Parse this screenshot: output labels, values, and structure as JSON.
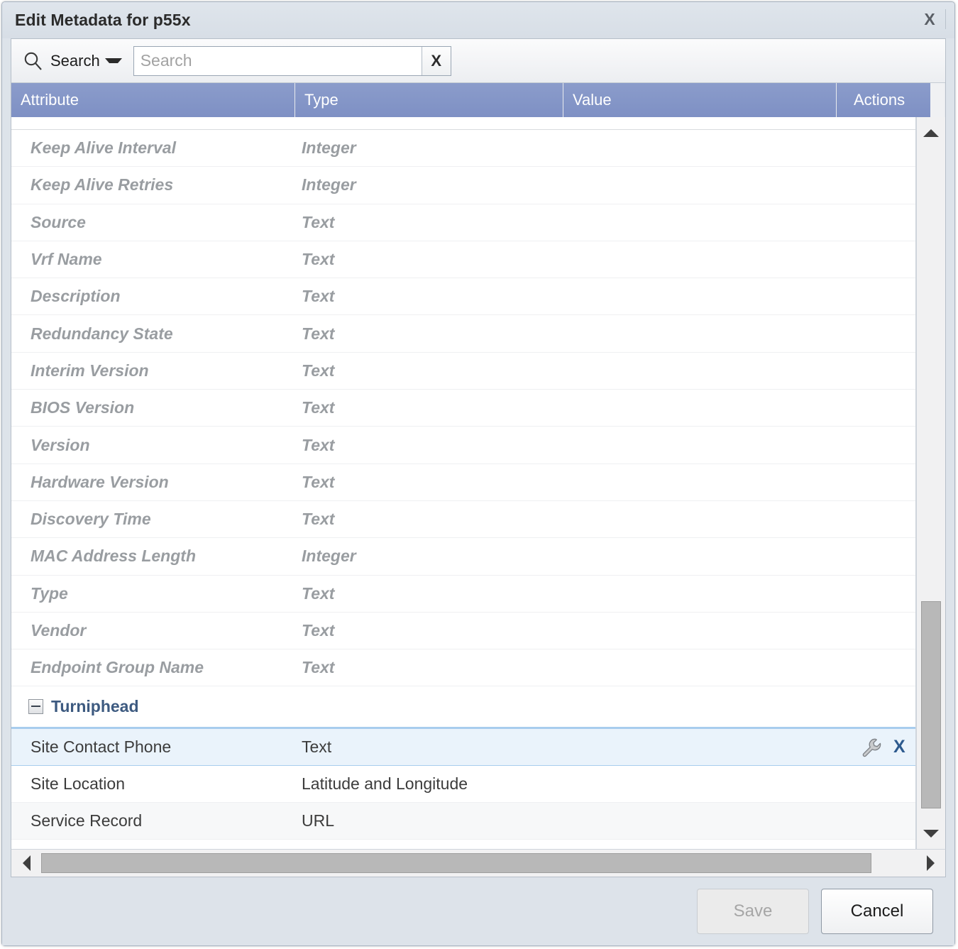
{
  "dialog": {
    "title": "Edit Metadata for p55x",
    "close_icon": "close-icon",
    "close_label": "X"
  },
  "toolbar": {
    "search_icon": "search-icon",
    "search_menu_label": "Search",
    "caret_icon": "chevron-down-icon",
    "search_value": "",
    "search_placeholder": "Search",
    "clear_label": "X"
  },
  "grid": {
    "columns": [
      "Attribute",
      "Type",
      "Value",
      "Actions"
    ],
    "clipped_row": {
      "attribute": "",
      "type": "",
      "value": ""
    },
    "inherited_rows": [
      {
        "attribute": "Keep Alive Interval",
        "type": "Integer",
        "value": ""
      },
      {
        "attribute": "Keep Alive Retries",
        "type": "Integer",
        "value": ""
      },
      {
        "attribute": "Source",
        "type": "Text",
        "value": ""
      },
      {
        "attribute": "Vrf Name",
        "type": "Text",
        "value": ""
      },
      {
        "attribute": "Description",
        "type": "Text",
        "value": ""
      },
      {
        "attribute": "Redundancy State",
        "type": "Text",
        "value": ""
      },
      {
        "attribute": "Interim Version",
        "type": "Text",
        "value": ""
      },
      {
        "attribute": "BIOS Version",
        "type": "Text",
        "value": ""
      },
      {
        "attribute": "Version",
        "type": "Text",
        "value": ""
      },
      {
        "attribute": "Hardware Version",
        "type": "Text",
        "value": ""
      },
      {
        "attribute": "Discovery Time",
        "type": "Text",
        "value": ""
      },
      {
        "attribute": "MAC Address Length",
        "type": "Integer",
        "value": ""
      },
      {
        "attribute": "Type",
        "type": "Text",
        "value": ""
      },
      {
        "attribute": "Vendor",
        "type": "Text",
        "value": ""
      },
      {
        "attribute": "Endpoint Group Name",
        "type": "Text",
        "value": ""
      }
    ],
    "group": {
      "label": "Turniphead",
      "toggle_icon": "collapse-minus-icon",
      "rows": [
        {
          "attribute": "Site Contact Phone",
          "type": "Text",
          "value": "",
          "selected": true,
          "edit_icon": "wrench-icon",
          "delete_icon": "close-icon",
          "delete_label": "X"
        },
        {
          "attribute": "Site Location",
          "type": "Latitude and Longitude",
          "value": "",
          "selected": false
        },
        {
          "attribute": "Service Record",
          "type": "URL",
          "value": "",
          "selected": false
        }
      ]
    }
  },
  "scrollbars": {
    "vertical": {
      "up_icon": "triangle-up-icon",
      "down_icon": "triangle-down-icon"
    },
    "horizontal": {
      "left_icon": "triangle-left-icon",
      "right_icon": "triangle-right-icon"
    }
  },
  "footer": {
    "save_label": "Save",
    "cancel_label": "Cancel"
  },
  "colors": {
    "header_blue": "#7e90c4",
    "group_label": "#3d5a80",
    "selection": "#eaf3fb",
    "dialog_chrome": "#dde3ea"
  }
}
